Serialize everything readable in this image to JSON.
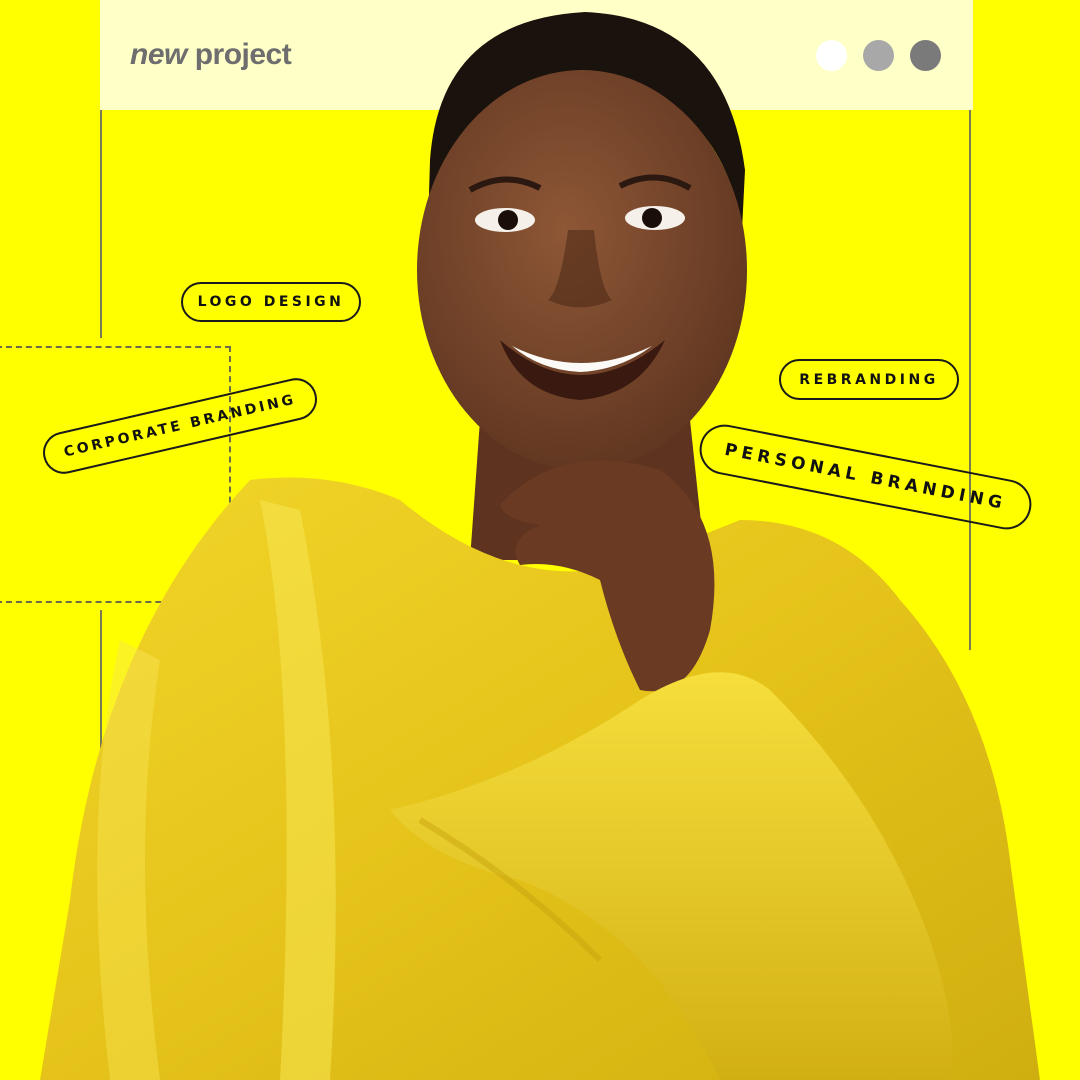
{
  "window": {
    "title_emphasis": "new",
    "title_rest": "project",
    "controls": [
      {
        "name": "white-dot",
        "color": "#FFFFFF"
      },
      {
        "name": "light-gray-dot",
        "color": "#A8A8A8"
      },
      {
        "name": "dark-gray-dot",
        "color": "#7A7A7A"
      }
    ]
  },
  "tags": {
    "logo_design": "LOGO DESIGN",
    "rebranding": "REBRANDING",
    "corporate_branding": "CORPORATE BRANDING",
    "personal_branding": "PERSONAL BRANDING"
  },
  "colors": {
    "background": "#FFFF00",
    "titlebar": "#FFFFC8",
    "dress": "#E8C81A",
    "skin": "#7A4A2C"
  }
}
